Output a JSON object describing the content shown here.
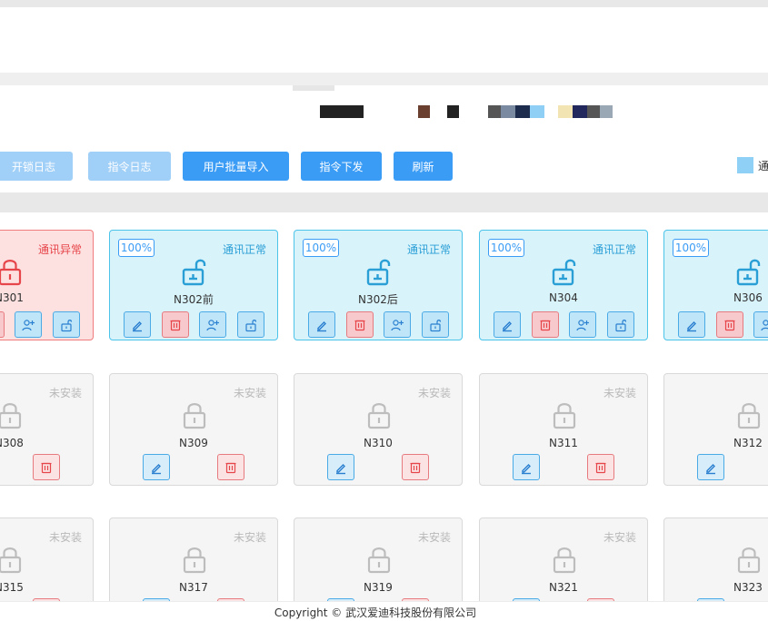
{
  "toolbar": {
    "buttons": [
      {
        "label": "开锁日志"
      },
      {
        "label": "指令日志"
      },
      {
        "label": "用户批量导入"
      },
      {
        "label": "指令下发"
      },
      {
        "label": "刷新"
      }
    ]
  },
  "legend": {
    "first_label": "通",
    "swatch_color": "#8fd1f6"
  },
  "rooms": [
    {
      "room": "N301",
      "status": "通讯异常",
      "kind": "error",
      "battery": ""
    },
    {
      "room": "N302前",
      "status": "通讯正常",
      "kind": "normal",
      "battery": "100%"
    },
    {
      "room": "N302后",
      "status": "通讯正常",
      "kind": "normal",
      "battery": "100%"
    },
    {
      "room": "N304",
      "status": "通讯正常",
      "kind": "normal",
      "battery": "100%"
    },
    {
      "room": "N306",
      "status": "",
      "kind": "normal",
      "battery": "100%"
    },
    {
      "room": "N308",
      "status": "未安装",
      "kind": "idle",
      "battery": ""
    },
    {
      "room": "N309",
      "status": "未安装",
      "kind": "idle",
      "battery": ""
    },
    {
      "room": "N310",
      "status": "未安装",
      "kind": "idle",
      "battery": ""
    },
    {
      "room": "N311",
      "status": "未安装",
      "kind": "idle",
      "battery": ""
    },
    {
      "room": "N312",
      "status": "",
      "kind": "idle",
      "battery": ""
    },
    {
      "room": "N315",
      "status": "未安装",
      "kind": "idle",
      "battery": ""
    },
    {
      "room": "N317",
      "status": "未安装",
      "kind": "idle",
      "battery": ""
    },
    {
      "room": "N319",
      "status": "未安装",
      "kind": "idle",
      "battery": ""
    },
    {
      "room": "N321",
      "status": "未安装",
      "kind": "idle",
      "battery": ""
    },
    {
      "room": "N323",
      "status": "",
      "kind": "idle",
      "battery": ""
    }
  ],
  "footer": {
    "copyright": "Copyright © 武汉爱迪科技股份有限公司"
  },
  "colors": {
    "primary": "#3b9cf5",
    "normal": "#2a9fd6",
    "error": "#e6454a",
    "idle": "#b9b9b9"
  }
}
